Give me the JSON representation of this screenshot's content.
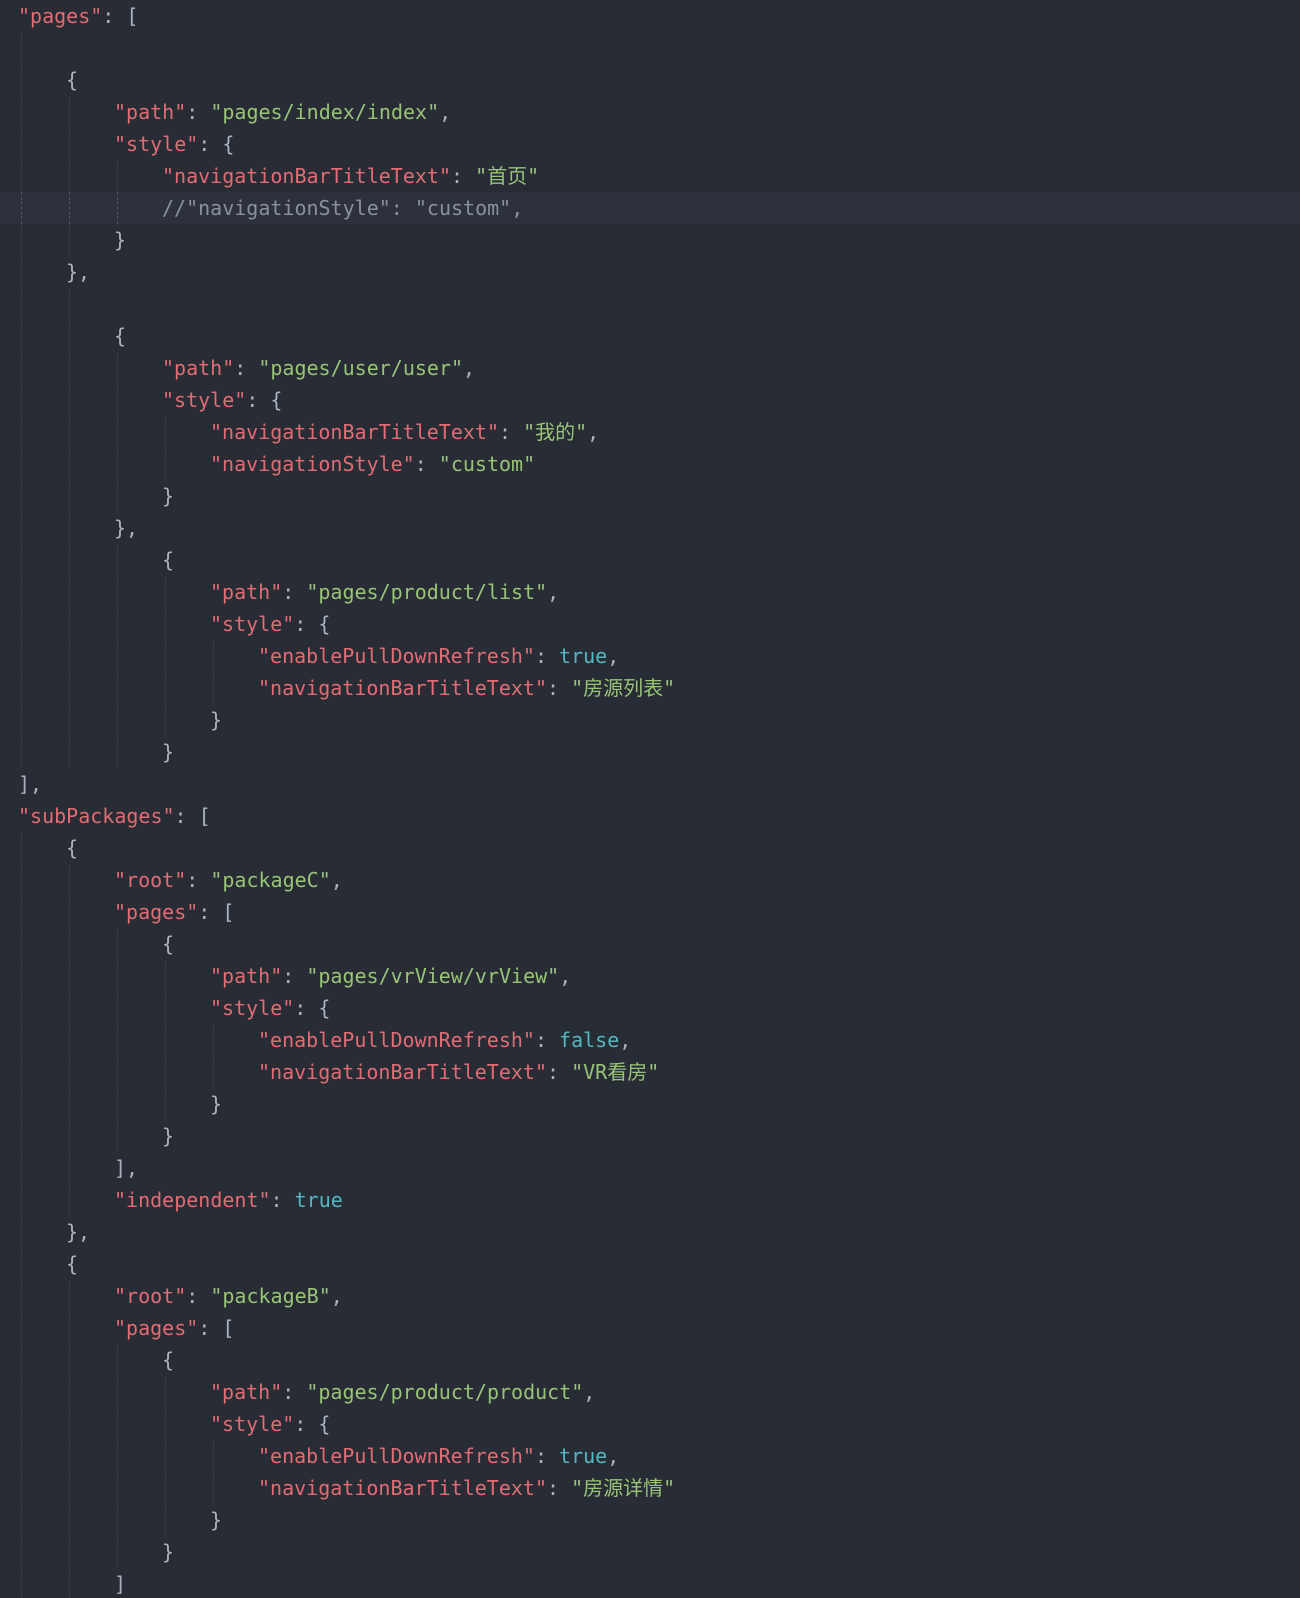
{
  "editor": {
    "theme": {
      "background": "#282c34",
      "key": "#e06c75",
      "string": "#98c379",
      "boolean": "#56b6c2",
      "punctuation": "#abb2bf",
      "comment": "#8a919e"
    },
    "active_line": 6,
    "lines": [
      {
        "indent": 0,
        "tokens": [
          [
            "k",
            "\"pages\""
          ],
          [
            "p",
            ": ["
          ]
        ]
      },
      {
        "indent": 0,
        "tokens": []
      },
      {
        "indent": 1,
        "tokens": [
          [
            "p",
            "{"
          ]
        ]
      },
      {
        "indent": 2,
        "tokens": [
          [
            "k",
            "\"path\""
          ],
          [
            "p",
            ": "
          ],
          [
            "s",
            "\"pages/index/index\""
          ],
          [
            "p",
            ","
          ]
        ]
      },
      {
        "indent": 2,
        "tokens": [
          [
            "k",
            "\"style\""
          ],
          [
            "p",
            ": {"
          ]
        ]
      },
      {
        "indent": 3,
        "tokens": [
          [
            "k",
            "\"navigationBarTitleText\""
          ],
          [
            "p",
            ": "
          ],
          [
            "s",
            "\"首页\""
          ]
        ]
      },
      {
        "indent": 3,
        "tokens": [
          [
            "c",
            "//\"navigationStyle\": \"custom\","
          ]
        ]
      },
      {
        "indent": 2,
        "tokens": [
          [
            "p",
            "}"
          ]
        ]
      },
      {
        "indent": 1,
        "tokens": [
          [
            "p",
            "},"
          ]
        ]
      },
      {
        "indent": 1,
        "tokens": []
      },
      {
        "indent": 2,
        "tokens": [
          [
            "p",
            "{"
          ]
        ]
      },
      {
        "indent": 3,
        "tokens": [
          [
            "k",
            "\"path\""
          ],
          [
            "p",
            ": "
          ],
          [
            "s",
            "\"pages/user/user\""
          ],
          [
            "p",
            ","
          ]
        ]
      },
      {
        "indent": 3,
        "tokens": [
          [
            "k",
            "\"style\""
          ],
          [
            "p",
            ": {"
          ]
        ]
      },
      {
        "indent": 4,
        "tokens": [
          [
            "k",
            "\"navigationBarTitleText\""
          ],
          [
            "p",
            ": "
          ],
          [
            "s",
            "\"我的\""
          ],
          [
            "p",
            ","
          ]
        ]
      },
      {
        "indent": 4,
        "tokens": [
          [
            "k",
            "\"navigationStyle\""
          ],
          [
            "p",
            ": "
          ],
          [
            "s",
            "\"custom\""
          ]
        ]
      },
      {
        "indent": 3,
        "tokens": [
          [
            "p",
            "}"
          ]
        ]
      },
      {
        "indent": 2,
        "tokens": [
          [
            "p",
            "},"
          ]
        ]
      },
      {
        "indent": 3,
        "tokens": [
          [
            "p",
            "{"
          ]
        ]
      },
      {
        "indent": 4,
        "tokens": [
          [
            "k",
            "\"path\""
          ],
          [
            "p",
            ": "
          ],
          [
            "s",
            "\"pages/product/list\""
          ],
          [
            "p",
            ","
          ]
        ]
      },
      {
        "indent": 4,
        "tokens": [
          [
            "k",
            "\"style\""
          ],
          [
            "p",
            ": {"
          ]
        ]
      },
      {
        "indent": 5,
        "tokens": [
          [
            "k",
            "\"enablePullDownRefresh\""
          ],
          [
            "p",
            ": "
          ],
          [
            "b",
            "true"
          ],
          [
            "p",
            ","
          ]
        ]
      },
      {
        "indent": 5,
        "tokens": [
          [
            "k",
            "\"navigationBarTitleText\""
          ],
          [
            "p",
            ": "
          ],
          [
            "s",
            "\"房源列表\""
          ]
        ]
      },
      {
        "indent": 4,
        "tokens": [
          [
            "p",
            "}"
          ]
        ]
      },
      {
        "indent": 3,
        "tokens": [
          [
            "p",
            "}"
          ]
        ]
      },
      {
        "indent": 0,
        "tokens": [
          [
            "p",
            "],"
          ]
        ]
      },
      {
        "indent": 0,
        "tokens": [
          [
            "k",
            "\"subPackages\""
          ],
          [
            "p",
            ": ["
          ]
        ]
      },
      {
        "indent": 1,
        "tokens": [
          [
            "p",
            "{"
          ]
        ]
      },
      {
        "indent": 2,
        "tokens": [
          [
            "k",
            "\"root\""
          ],
          [
            "p",
            ": "
          ],
          [
            "s",
            "\"packageC\""
          ],
          [
            "p",
            ","
          ]
        ]
      },
      {
        "indent": 2,
        "tokens": [
          [
            "k",
            "\"pages\""
          ],
          [
            "p",
            ": ["
          ]
        ]
      },
      {
        "indent": 3,
        "tokens": [
          [
            "p",
            "{"
          ]
        ]
      },
      {
        "indent": 4,
        "tokens": [
          [
            "k",
            "\"path\""
          ],
          [
            "p",
            ": "
          ],
          [
            "s",
            "\"pages/vrView/vrView\""
          ],
          [
            "p",
            ","
          ]
        ]
      },
      {
        "indent": 4,
        "tokens": [
          [
            "k",
            "\"style\""
          ],
          [
            "p",
            ": {"
          ]
        ]
      },
      {
        "indent": 5,
        "tokens": [
          [
            "k",
            "\"enablePullDownRefresh\""
          ],
          [
            "p",
            ": "
          ],
          [
            "b",
            "false"
          ],
          [
            "p",
            ","
          ]
        ]
      },
      {
        "indent": 5,
        "tokens": [
          [
            "k",
            "\"navigationBarTitleText\""
          ],
          [
            "p",
            ": "
          ],
          [
            "s",
            "\"VR看房\""
          ]
        ]
      },
      {
        "indent": 4,
        "tokens": [
          [
            "p",
            "}"
          ]
        ]
      },
      {
        "indent": 3,
        "tokens": [
          [
            "p",
            "}"
          ]
        ]
      },
      {
        "indent": 2,
        "tokens": [
          [
            "p",
            "],"
          ]
        ]
      },
      {
        "indent": 2,
        "tokens": [
          [
            "k",
            "\"independent\""
          ],
          [
            "p",
            ": "
          ],
          [
            "b",
            "true"
          ]
        ]
      },
      {
        "indent": 1,
        "tokens": [
          [
            "p",
            "},"
          ]
        ]
      },
      {
        "indent": 1,
        "tokens": [
          [
            "p",
            "{"
          ]
        ]
      },
      {
        "indent": 2,
        "tokens": [
          [
            "k",
            "\"root\""
          ],
          [
            "p",
            ": "
          ],
          [
            "s",
            "\"packageB\""
          ],
          [
            "p",
            ","
          ]
        ]
      },
      {
        "indent": 2,
        "tokens": [
          [
            "k",
            "\"pages\""
          ],
          [
            "p",
            ": ["
          ]
        ]
      },
      {
        "indent": 3,
        "tokens": [
          [
            "p",
            "{"
          ]
        ]
      },
      {
        "indent": 4,
        "tokens": [
          [
            "k",
            "\"path\""
          ],
          [
            "p",
            ": "
          ],
          [
            "s",
            "\"pages/product/product\""
          ],
          [
            "p",
            ","
          ]
        ]
      },
      {
        "indent": 4,
        "tokens": [
          [
            "k",
            "\"style\""
          ],
          [
            "p",
            ": {"
          ]
        ]
      },
      {
        "indent": 5,
        "tokens": [
          [
            "k",
            "\"enablePullDownRefresh\""
          ],
          [
            "p",
            ": "
          ],
          [
            "b",
            "true"
          ],
          [
            "p",
            ","
          ]
        ]
      },
      {
        "indent": 5,
        "tokens": [
          [
            "k",
            "\"navigationBarTitleText\""
          ],
          [
            "p",
            ": "
          ],
          [
            "s",
            "\"房源详情\""
          ]
        ]
      },
      {
        "indent": 4,
        "tokens": [
          [
            "p",
            "}"
          ]
        ]
      },
      {
        "indent": 3,
        "tokens": [
          [
            "p",
            "}"
          ]
        ]
      },
      {
        "indent": 2,
        "tokens": [
          [
            "p",
            "]"
          ]
        ]
      }
    ]
  }
}
